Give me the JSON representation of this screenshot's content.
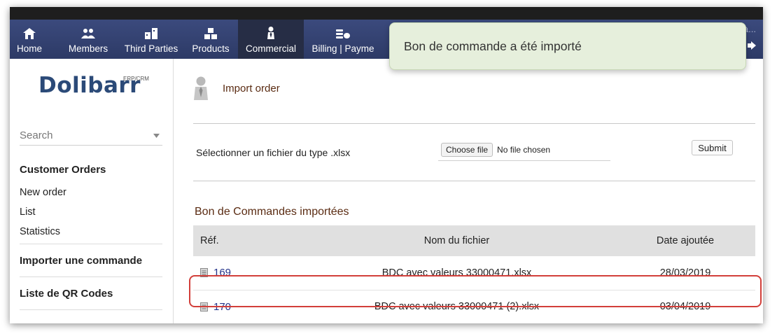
{
  "menu": [
    {
      "label": "Home",
      "icon": "home-icon"
    },
    {
      "label": "Members",
      "icon": "members-icon"
    },
    {
      "label": "Third Parties",
      "icon": "third-parties-icon"
    },
    {
      "label": "Products",
      "icon": "products-icon"
    },
    {
      "label": "Commercial",
      "icon": "commercial-icon",
      "active": true
    },
    {
      "label": "Billing | Payme",
      "icon": "billing-icon"
    }
  ],
  "user": {
    "name": "UserName La..."
  },
  "toast": {
    "message": "Bon de commande a été importé"
  },
  "sidebar": {
    "logo": "Dolibarr",
    "logo_sup": "ERP/CRM",
    "search_placeholder": "Search",
    "section1": "Customer Orders",
    "links": [
      "New order",
      "List",
      "Statistics"
    ],
    "section2": "Importer une commande",
    "section3": "Liste de QR Codes"
  },
  "main": {
    "title": "Import order",
    "file_label": "Sélectionner un fichier du type .xlsx",
    "choose_file": "Choose file",
    "no_file": "No file chosen",
    "submit": "Submit",
    "section_title": "Bon de Commandes importées",
    "table": {
      "headers": [
        "Réf.",
        "Nom du fichier",
        "Date ajoutée"
      ],
      "rows": [
        {
          "ref": "169",
          "file": "BDC avec valeurs 33000471.xlsx",
          "date": "28/03/2019"
        },
        {
          "ref": "170",
          "file": "BDC avec valeurs 33000471 (2).xlsx",
          "date": "03/04/2019"
        }
      ]
    }
  },
  "colors": {
    "topbar": "#2d3a66",
    "active_tab": "#262d45",
    "toast_bg": "#e6efdc",
    "title_brown": "#5a2b12",
    "link_blue": "#24338a",
    "highlight_red": "#d23f3a"
  }
}
